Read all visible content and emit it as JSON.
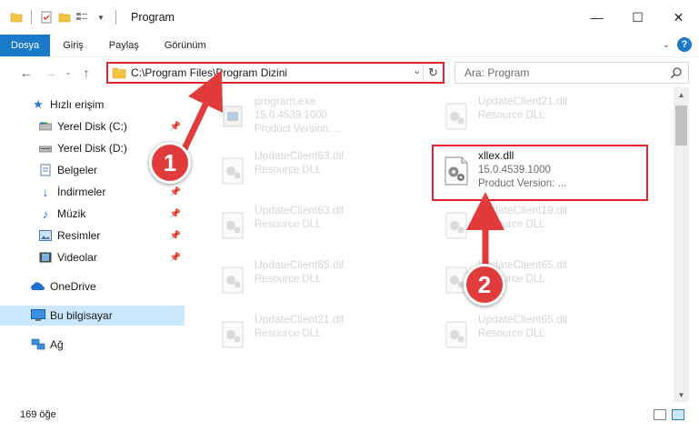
{
  "window": {
    "title": "Program",
    "controls": {
      "minimize": "—",
      "maximize": "☐",
      "close": "✕"
    }
  },
  "ribbon": {
    "tabs": [
      {
        "label": "Dosya",
        "active": true
      },
      {
        "label": "Giriş",
        "active": false
      },
      {
        "label": "Paylaş",
        "active": false
      },
      {
        "label": "Görünüm",
        "active": false
      }
    ],
    "help_label": "?"
  },
  "nav": {
    "address_path": "C:\\Program Files\\Program Dizini",
    "search_placeholder": "Ara: Program"
  },
  "sidebar": {
    "quick_access": "Hızlı erişim",
    "items": [
      {
        "label": "Yerel Disk (C:)",
        "icon": "drive-icon",
        "pinned": true
      },
      {
        "label": "Yerel Disk (D:)",
        "icon": "drive-icon",
        "pinned": true
      },
      {
        "label": "Belgeler",
        "icon": "documents-icon",
        "pinned": true
      },
      {
        "label": "İndirmeler",
        "icon": "downloads-icon",
        "pinned": true
      },
      {
        "label": "Müzik",
        "icon": "music-icon",
        "pinned": true
      },
      {
        "label": "Resimler",
        "icon": "pictures-icon",
        "pinned": true
      },
      {
        "label": "Videolar",
        "icon": "videos-icon",
        "pinned": true
      }
    ],
    "onedrive": "OneDrive",
    "this_pc": "Bu bilgisayar",
    "network": "Ağ"
  },
  "files": {
    "program": {
      "name": "program.exe",
      "line1": "15.0.4539.1000",
      "line2": "Product Version:     ..."
    },
    "uc21_top": {
      "name": "UpdateClient21.dll",
      "line1": "Resource DLL"
    },
    "uc63": {
      "name": "UpdateClient63.dll",
      "line1": "Resource DLL"
    },
    "xllex": {
      "name": "xllex.dll",
      "line1": "15.0.4539.1000",
      "line2": "Product Version:     ..."
    },
    "uc63b": {
      "name": "UpdateClient63.dll",
      "line1": "Resource DLL"
    },
    "uc19": {
      "name": "UpdateClient19.dll",
      "line1": "Resource DLL"
    },
    "uc65a": {
      "name": "UpdateClient65.dll",
      "line1": "Resource DLL"
    },
    "uc65b": {
      "name": "UpdateClient65.dll",
      "line1": "Resource DLL"
    },
    "uc21b": {
      "name": "UpdateClient21.dll",
      "line1": "Resource DLL"
    },
    "uc65c": {
      "name": "UpdateClient65.dll",
      "line1": "Resource DLL"
    }
  },
  "status": {
    "item_count": "169 öğe"
  },
  "annotations": {
    "step1": "1",
    "step2": "2",
    "accent": "#e23b3b"
  }
}
